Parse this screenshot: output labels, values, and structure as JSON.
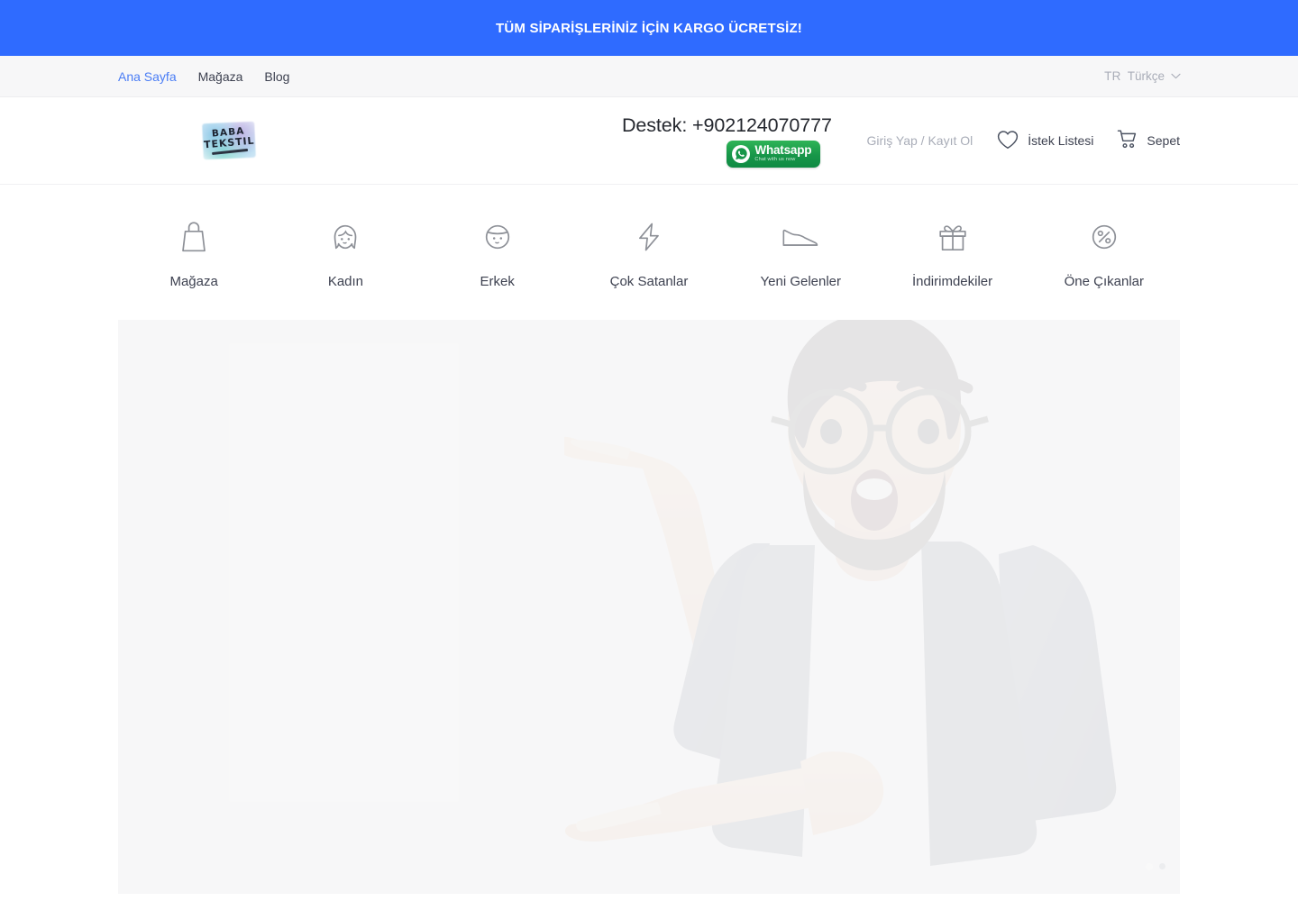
{
  "promo": {
    "text": "TÜM SİPARİŞLERİNİZ İÇİN KARGO ÜCRETSİZ!",
    "background": "#2f6bff",
    "text_color": "#ffffff"
  },
  "subnav": {
    "links": [
      {
        "label": "Ana Sayfa",
        "active": true
      },
      {
        "label": "Mağaza",
        "active": false
      },
      {
        "label": "Blog",
        "active": false
      }
    ],
    "language": {
      "code": "TR",
      "name": "Türkçe",
      "chevron": "chevron-down-icon"
    },
    "active_color": "#4a7df5"
  },
  "header": {
    "logo": {
      "line1": "BABA",
      "line2": "TEKSTIL",
      "alt": "Baba Tekstil"
    },
    "support": {
      "label": "Destek: +902124070777",
      "whatsapp": {
        "title": "Whatsapp",
        "subtitle": "Chat with us now",
        "icon": "whatsapp-icon",
        "color": "#179649"
      }
    },
    "account": {
      "login_label": "Giriş Yap / Kayıt Ol",
      "wishlist_label": "İstek Listesi",
      "wishlist_icon": "heart-icon",
      "cart_label": "Sepet",
      "cart_icon": "shopping-cart-icon"
    }
  },
  "categories": [
    {
      "label": "Mağaza",
      "icon": "shopping-bag-icon"
    },
    {
      "label": "Kadın",
      "icon": "woman-face-icon"
    },
    {
      "label": "Erkek",
      "icon": "man-face-icon"
    },
    {
      "label": "Çok Satanlar",
      "icon": "lightning-bolt-icon"
    },
    {
      "label": "Yeni Gelenler",
      "icon": "shoe-icon"
    },
    {
      "label": "İndirimdekiler",
      "icon": "gift-icon"
    },
    {
      "label": "Öne Çıkanlar",
      "icon": "percent-circle-icon"
    }
  ],
  "hero": {
    "background": "#f7f7f8",
    "image_description": "Surprised bearded man with round glasses wearing grey cardigan presenting with open palms",
    "slides": 3,
    "active_slide": 1
  }
}
